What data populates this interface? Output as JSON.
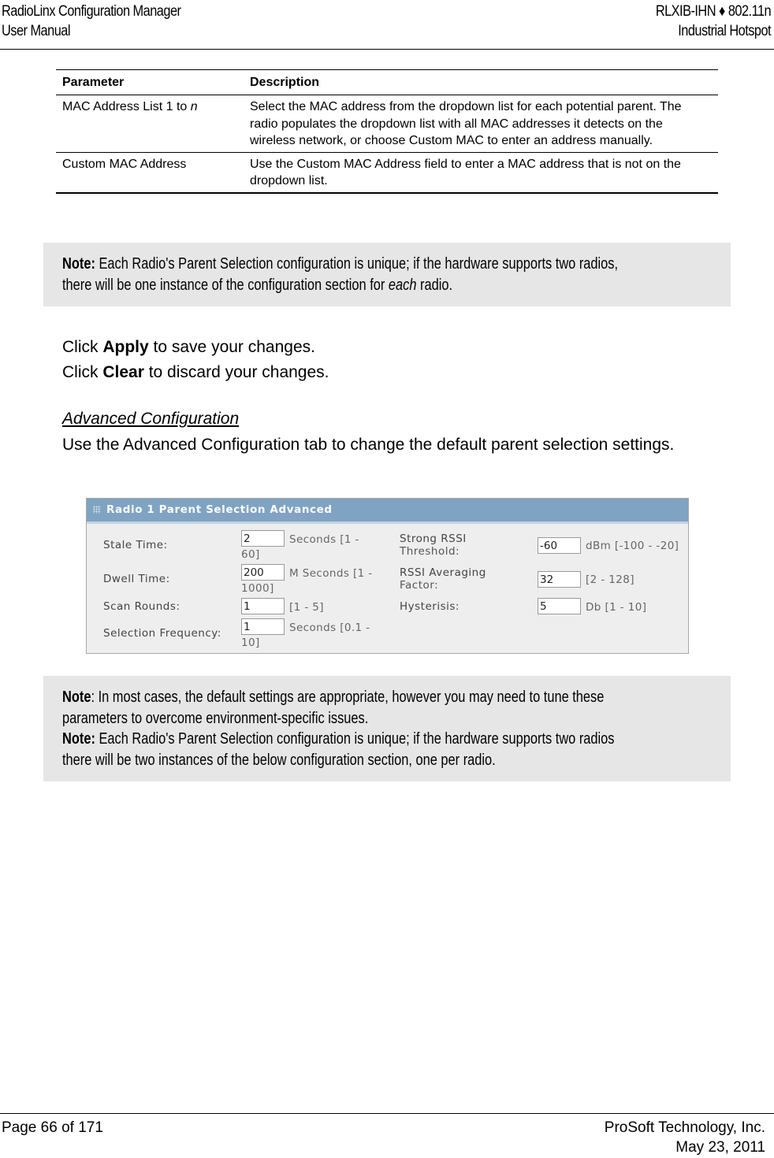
{
  "header": {
    "left_line1": "RadioLinx Configuration Manager",
    "left_line2": "User Manual",
    "right_line1": "RLXIB-IHN ♦ 802.11n",
    "right_line2": "Industrial Hotspot"
  },
  "param_table": {
    "headers": [
      "Parameter",
      "Description"
    ],
    "rows": [
      {
        "parameter_prefix": "MAC Address List 1 to ",
        "parameter_italic": "n",
        "description": "Select the MAC address from the dropdown list for each potential parent. The radio populates the dropdown list with all MAC addresses it detects on the wireless network, or choose Custom MAC to enter an address manually."
      },
      {
        "parameter_prefix": "Custom MAC Address",
        "parameter_italic": "",
        "description": "Use the Custom MAC Address field to enter a MAC address that is not on the dropdown list."
      }
    ]
  },
  "note1": {
    "label": "Note:",
    "text_before_italic": " Each Radio's Parent Selection configuration is unique; if the hardware supports two radios,",
    "line2_before_italic": "there will be one instance of the configuration section for ",
    "italic": "each",
    "line2_after_italic": " radio."
  },
  "instructions": {
    "apply_prefix": "Click ",
    "apply_bold": "Apply",
    "apply_suffix": " to save your changes.",
    "clear_prefix": "Click ",
    "clear_bold": "Clear",
    "clear_suffix": " to discard your changes."
  },
  "advanced": {
    "heading": "Advanced Configuration",
    "description": "Use the Advanced Configuration tab to change the default parent selection settings."
  },
  "panel": {
    "title": "Radio 1 Parent Selection Advanced",
    "accent_color": "#7fa3c3",
    "left_fields": [
      {
        "label": "Stale Time:",
        "value": "2",
        "unit_line1": "Seconds [1 -",
        "unit_line2": "60]"
      },
      {
        "label": "Dwell Time:",
        "value": "200",
        "unit_line1": "M Seconds [1 -",
        "unit_line2": "1000]"
      },
      {
        "label": "Scan Rounds:",
        "value": "1",
        "unit_line1": "[1 - 5]",
        "unit_line2": ""
      },
      {
        "label": "Selection Frequency:",
        "value": "1",
        "unit_line1": "Seconds [0.1 -",
        "unit_line2": "10]"
      }
    ],
    "right_fields": [
      {
        "label_line1": "Strong RSSI",
        "label_line2": "Threshold:",
        "value": "-60",
        "unit": "dBm [-100 - -20]"
      },
      {
        "label_line1": "RSSI Averaging",
        "label_line2": "Factor:",
        "value": "32",
        "unit": "[2 - 128]"
      },
      {
        "label_line1": "Hysterisis:",
        "label_line2": "",
        "value": "5",
        "unit": "Db [1 - 10]"
      }
    ]
  },
  "note2": {
    "label1": "Note",
    "text1_line1": ": In most cases, the default settings are appropriate, however you may need to tune these",
    "text1_line2": "parameters to overcome environment-specific issues.",
    "label2": "Note:",
    "text2_line1": " Each Radio's Parent Selection configuration is unique; if the hardware supports two radios",
    "text2_line2": "there will be two instances of the below configuration section, one per radio."
  },
  "footer": {
    "page": "Page 66 of 171",
    "company": "ProSoft Technology, Inc.",
    "date": "May 23, 2011"
  }
}
